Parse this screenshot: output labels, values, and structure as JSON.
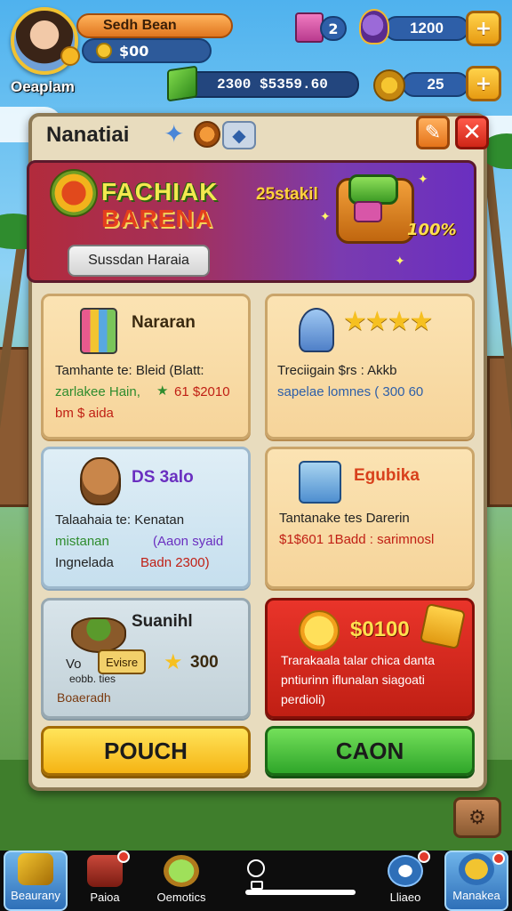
{
  "hud": {
    "player_name": "Oeaplam",
    "name_pill": "Sedh Bean",
    "coins": "$00",
    "gems": "2300 $5359.60",
    "book_count": "2",
    "resource_count": "1200",
    "resource2_count": "25",
    "plus_symbol": "+"
  },
  "panel": {
    "title": "Nanatiai",
    "close_symbol": "✕",
    "banner": {
      "title_line1": "FACHIAK",
      "title_line2": "BARENA",
      "subtitle": "25stakil",
      "percent": "100%",
      "button": "Sussdan Haraia"
    },
    "cards": [
      {
        "title": "Nararan",
        "line1": "Tamhante te: Bleid (Blatt:",
        "line2a": "zarlakee Hain,",
        "line2b": "61 $2010",
        "line3": "bm $ aida"
      },
      {
        "title": "",
        "line1": "Treciigain $rs : Akkb",
        "line2": "sapelae lomnes ( 300 60"
      },
      {
        "title": "DS 3alo",
        "line1": "Talaahaia te: Kenatan",
        "line2a": "mistanan",
        "line2b": "(Aaon syaid",
        "line3a": "Ingnelada",
        "line3b": "Badn 2300)"
      },
      {
        "title": "Egubika",
        "line1": "Tantanake tes Darerin",
        "line2": "$1$601 1Badd : sarimnosl"
      },
      {
        "title": "Suanihl",
        "tag": "Evisre",
        "price": "300",
        "line1": "Vo",
        "line2": "eobb. ties",
        "line3": "Boaeradh"
      },
      {
        "title": "$0100",
        "line1": "Trarakaala talar chica danta",
        "line2": "pntiurinn iflunalan siagoati",
        "line3": "perdioli)"
      }
    ],
    "button_left": "POUCH",
    "button_right": "CAON"
  },
  "nav": {
    "items": [
      {
        "label": "Beaurany"
      },
      {
        "label": "Paioa"
      },
      {
        "label": "Oemotics"
      },
      {
        "label": "Lliaeo"
      },
      {
        "label": "Manakea"
      }
    ]
  },
  "colors": {
    "accent_yellow": "#f5b414",
    "accent_green": "#2fa62a",
    "danger_red": "#c01f14",
    "banner_purple": "#7a3bb0"
  },
  "icons": [
    "avatar",
    "coin-icon",
    "book-icon",
    "dragon-icon",
    "gem-box-icon",
    "horn-icon",
    "star-icon",
    "chest-icon"
  ]
}
